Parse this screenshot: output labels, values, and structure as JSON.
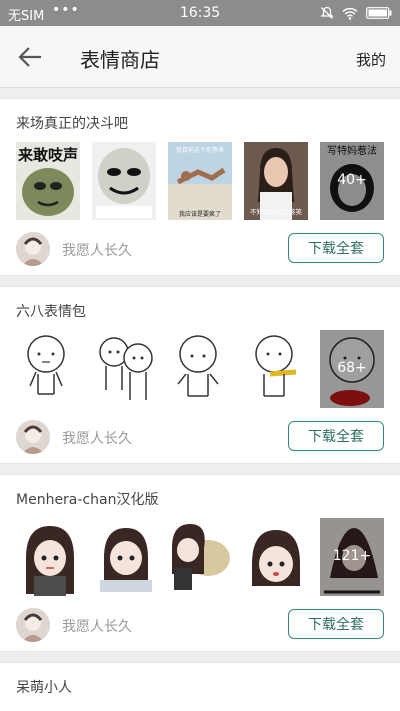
{
  "status_bar": {
    "carrier": "无SIM",
    "dots": "•••",
    "time": "16:35"
  },
  "app_bar": {
    "title": "表情商店",
    "mine": "我的"
  },
  "packs": [
    {
      "title": "来场真正的决斗吧",
      "author": "我愿人长久",
      "download": "下载全套",
      "more_count": "40+",
      "captions": [
        "来敢吱声",
        "",
        "我目前这个形势来\n我应该是要疯了",
        "不知该哭还是该笑",
        "写特妈惹法"
      ]
    },
    {
      "title": "六八表情包",
      "author": "我愿人长久",
      "download": "下载全套",
      "more_count": "68+"
    },
    {
      "title": "Menhera-chan汉化版",
      "author": "我愿人长久",
      "download": "下载全套",
      "more_count": "121+"
    },
    {
      "title": "呆萌小人"
    }
  ],
  "colors": {
    "status_bg": "#8c8c8c",
    "accent": "#2f8f7e",
    "author_text": "#9a9a9a"
  }
}
